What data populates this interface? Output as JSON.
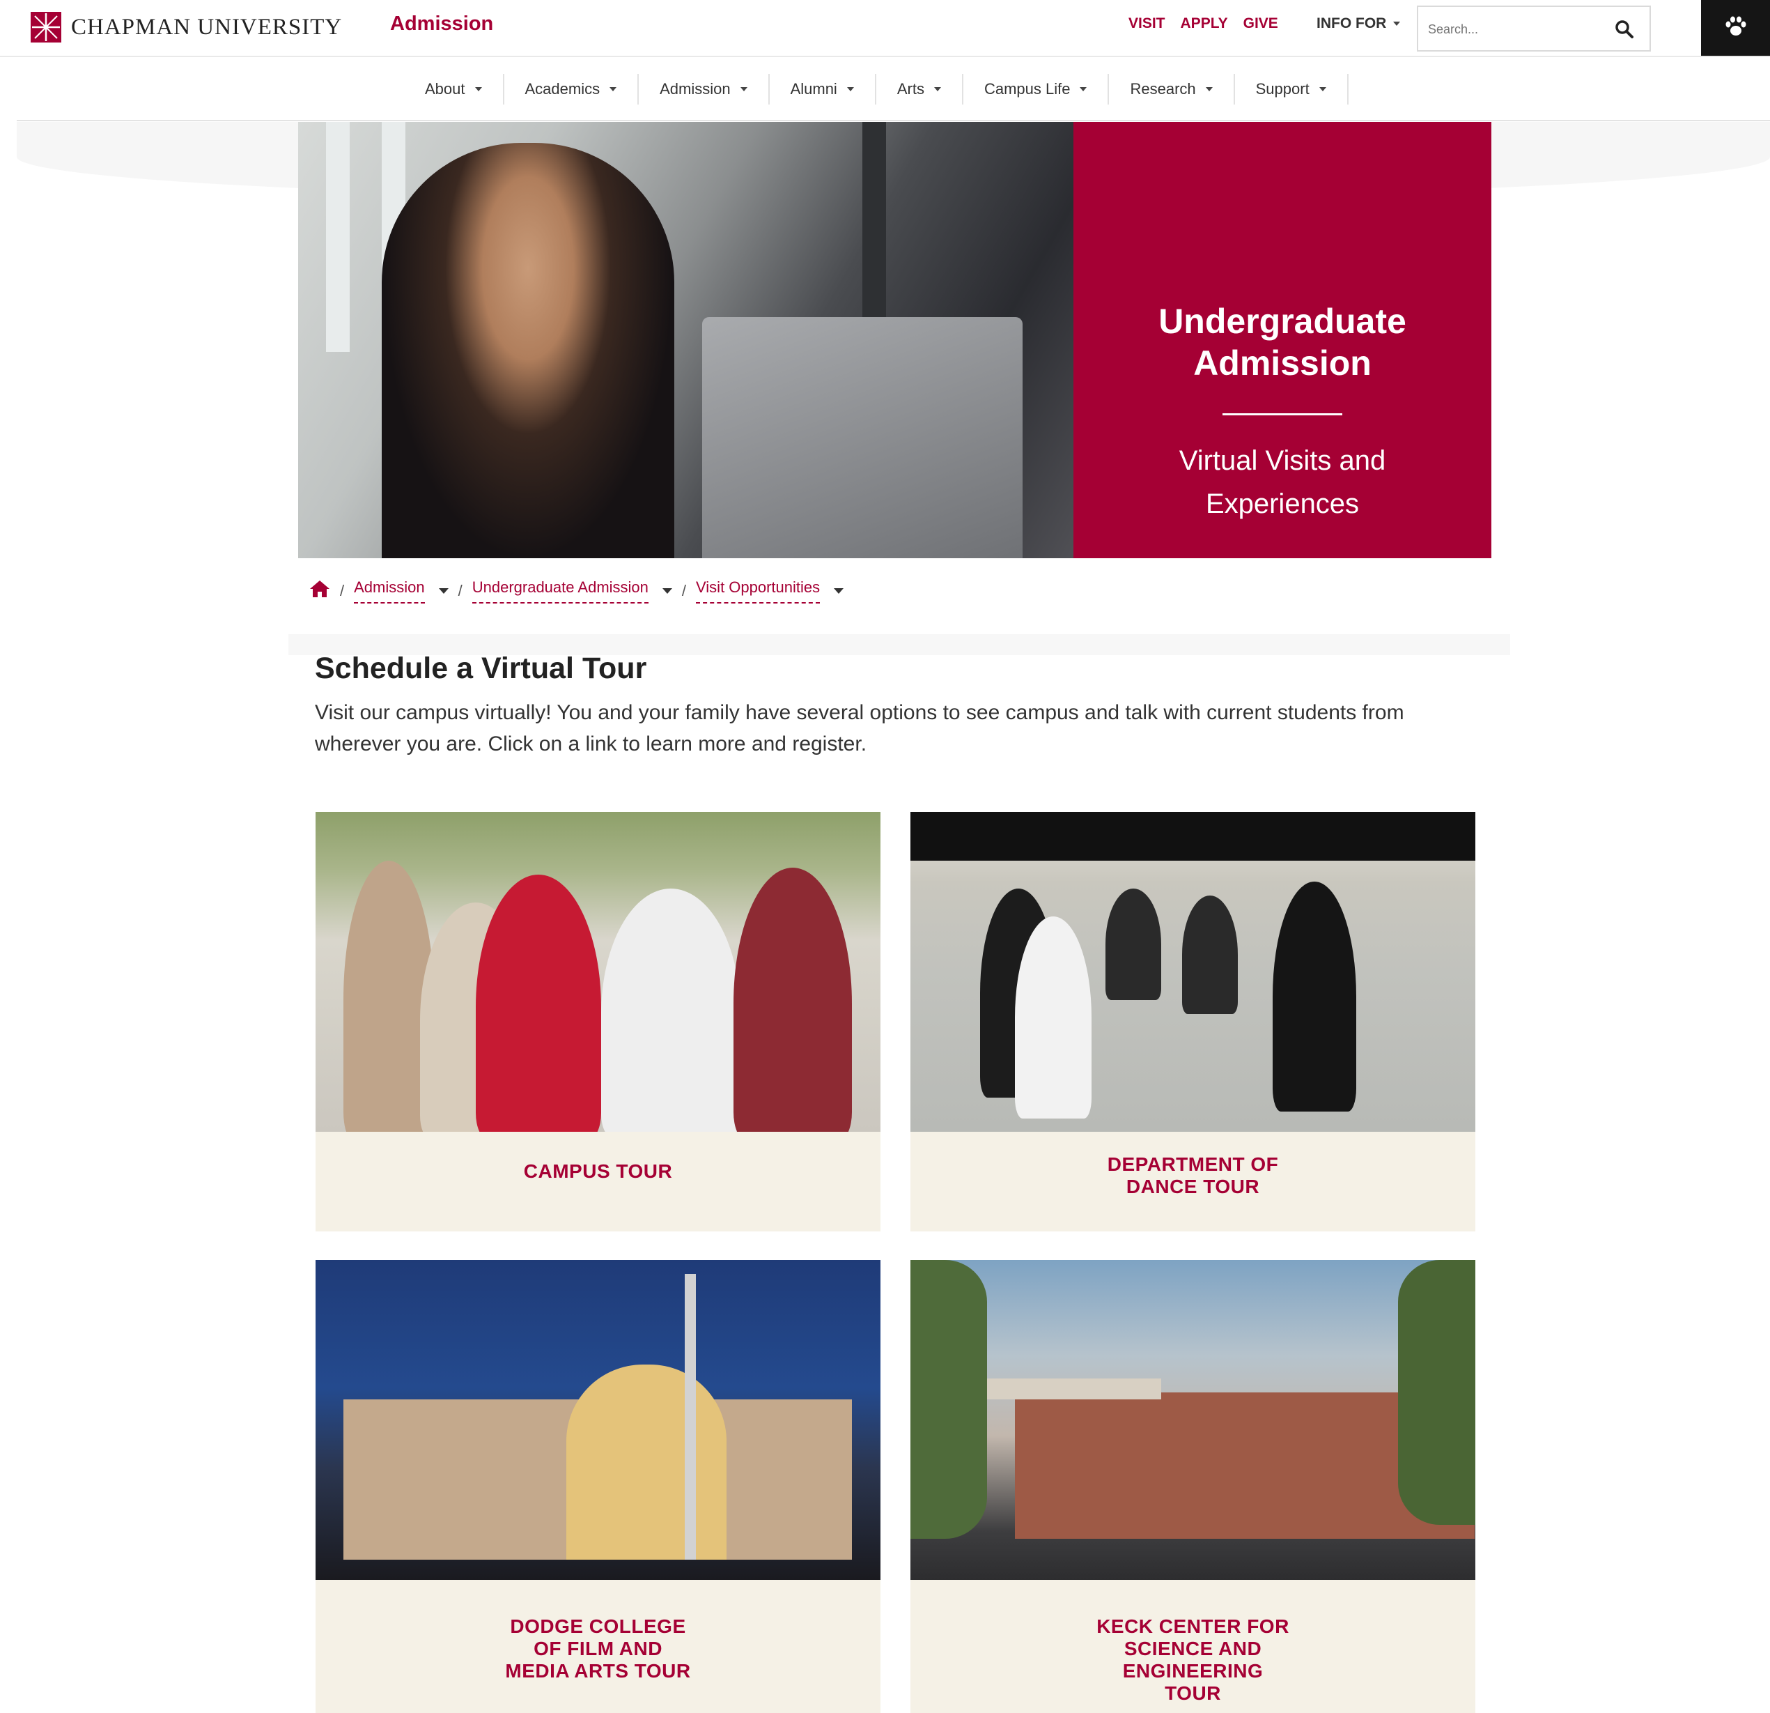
{
  "header": {
    "logo_text": "CHAPMAN UNIVERSITY",
    "site_name": "Admission",
    "util_links": [
      "VISIT",
      "APPLY",
      "GIVE"
    ],
    "info_for": "INFO FOR",
    "search_placeholder": "Search..."
  },
  "nav": {
    "items": [
      {
        "label": "About"
      },
      {
        "label": "Academics"
      },
      {
        "label": "Admission"
      },
      {
        "label": "Alumni"
      },
      {
        "label": "Arts"
      },
      {
        "label": "Campus Life"
      },
      {
        "label": "Research"
      },
      {
        "label": "Support"
      }
    ]
  },
  "hero": {
    "title": "Undergraduate Admission",
    "subtitle": "Virtual Visits and Experiences"
  },
  "breadcrumb": {
    "items": [
      "Admission",
      "Undergraduate Admission",
      "Visit Opportunities"
    ]
  },
  "content": {
    "title": "Schedule a Virtual Tour",
    "intro": "Visit our campus virtually! You and your family have several options to see campus and talk with current students from wherever you are. Click on a link to learn more and register."
  },
  "cards": [
    {
      "label_lines": [
        "CAMPUS TOUR"
      ]
    },
    {
      "label_lines": [
        "DEPARTMENT OF",
        "DANCE TOUR"
      ]
    },
    {
      "label_lines": [
        "DODGE COLLEGE",
        "OF FILM AND",
        "MEDIA ARTS TOUR"
      ]
    },
    {
      "label_lines": [
        "KECK CENTER FOR",
        "SCIENCE AND",
        "ENGINEERING",
        "TOUR"
      ]
    }
  ],
  "colors": {
    "brand": "#a50034",
    "card_bg": "#f5f1e6",
    "paw_button": "#151515"
  },
  "icons": [
    "home-icon",
    "search-icon",
    "paw-icon",
    "chevron-down-icon"
  ]
}
